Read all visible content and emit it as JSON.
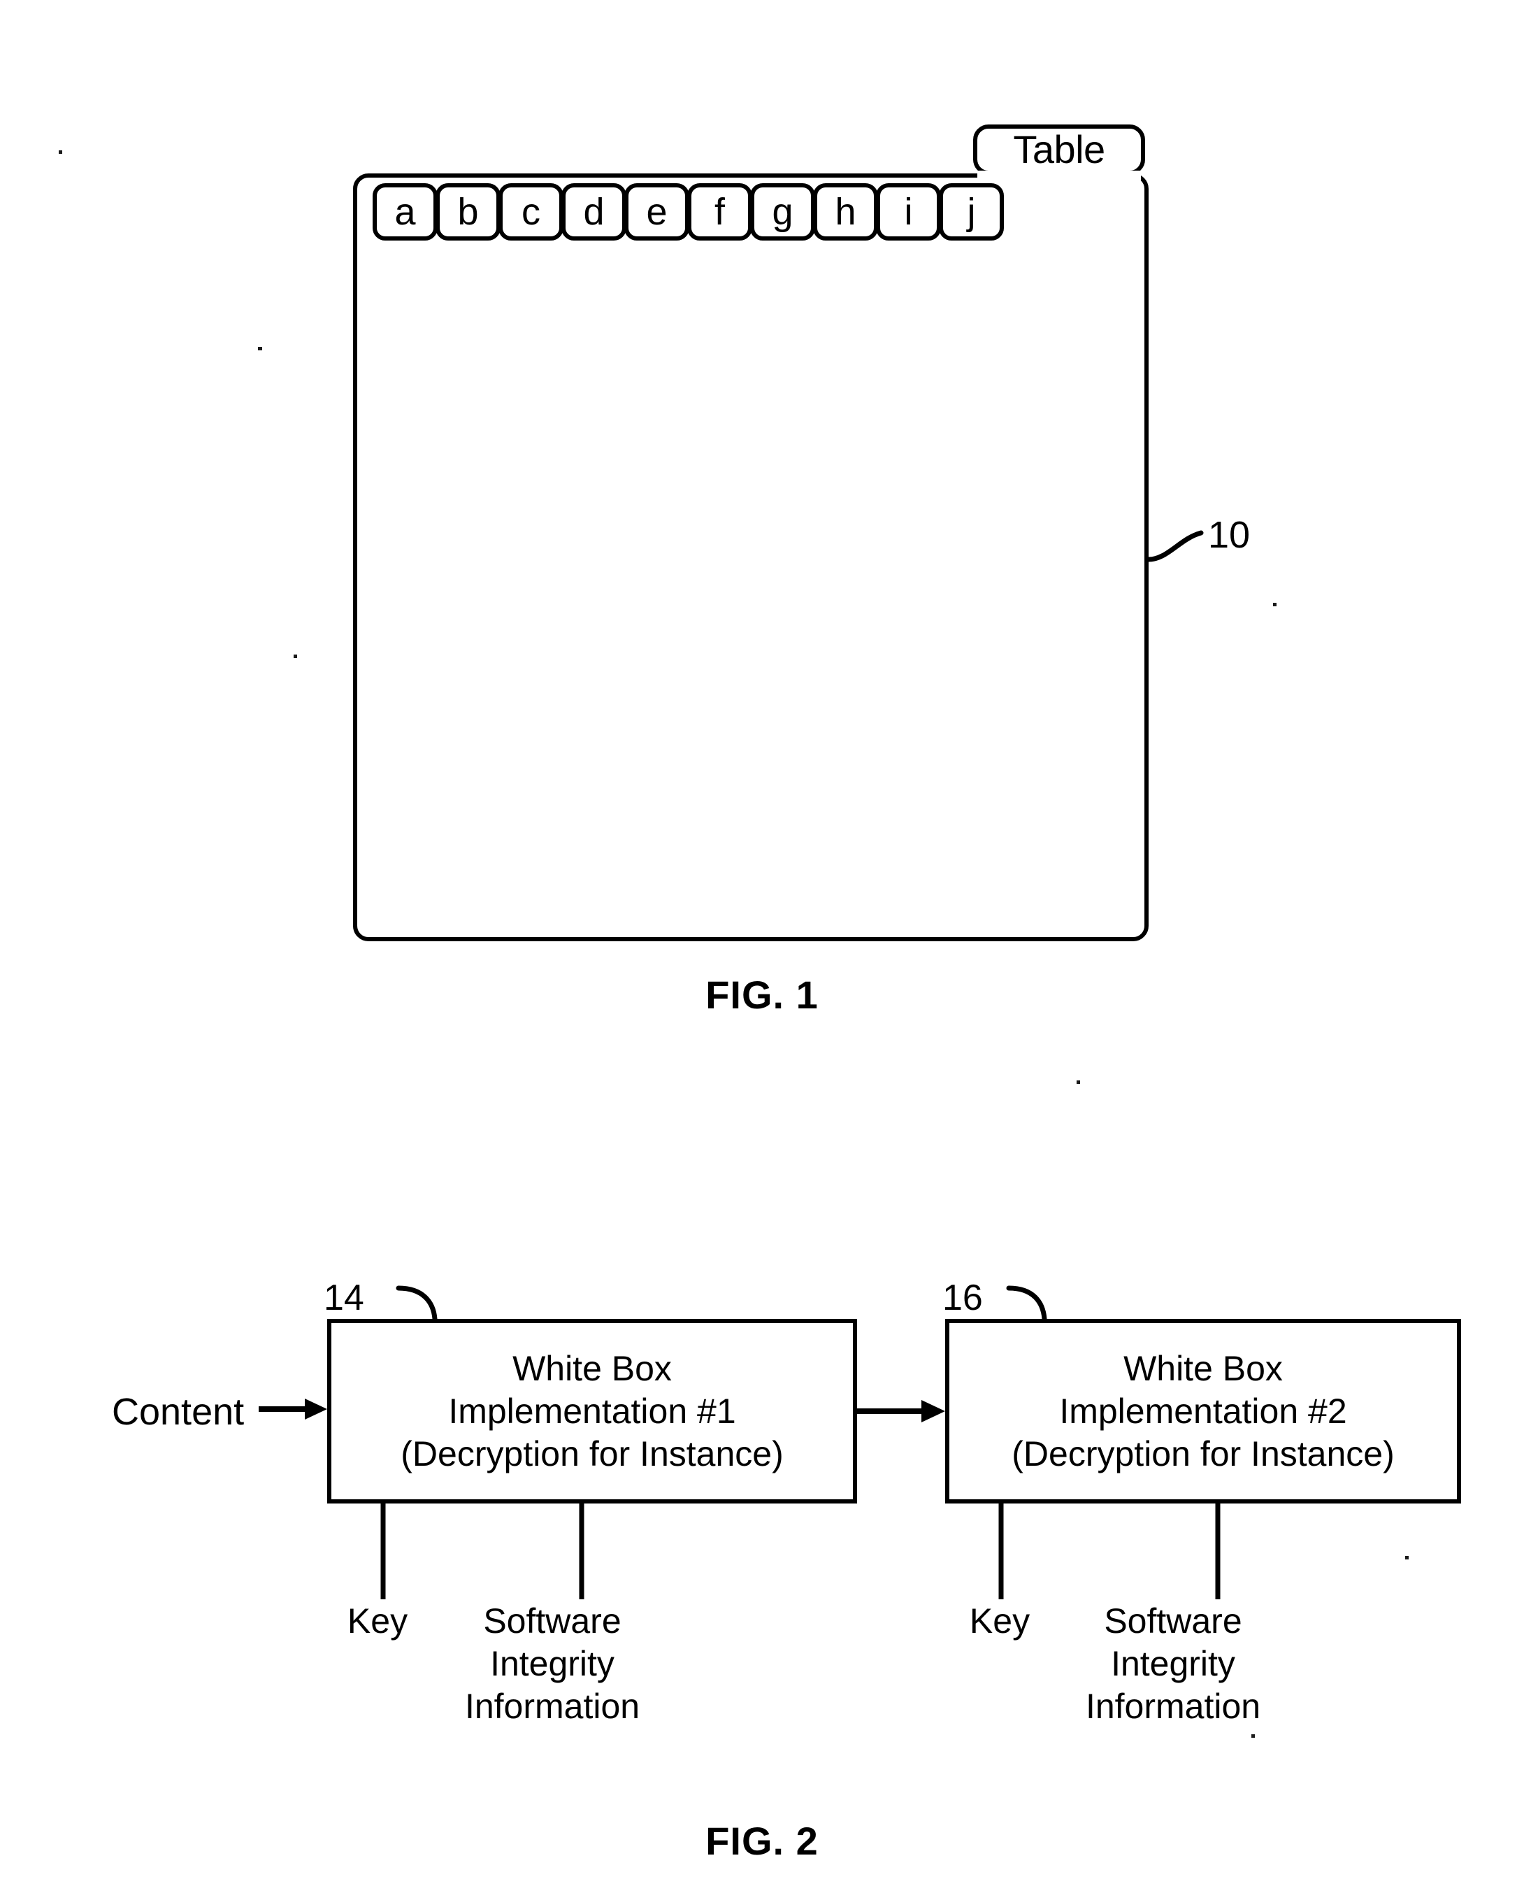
{
  "page": {
    "background_color": "#ffffff",
    "ink_color": "#000000",
    "document_type": "patent-drawing-sheet"
  },
  "fig1": {
    "caption": "FIG. 1",
    "tab_label": "Table",
    "reference_numeral": "10",
    "table_cells": [
      {
        "label": "a"
      },
      {
        "label": "b"
      },
      {
        "label": "c"
      },
      {
        "label": "d"
      },
      {
        "label": "e"
      },
      {
        "label": "f"
      },
      {
        "label": "g"
      },
      {
        "label": "h"
      },
      {
        "label": "i"
      },
      {
        "label": "j"
      }
    ]
  },
  "fig2": {
    "caption": "FIG. 2",
    "input_label": "Content",
    "blocks": [
      {
        "reference_numeral": "14",
        "line1": "White Box",
        "line2": "Implementation #1",
        "line3": "(Decryption for Instance)",
        "inputs": [
          {
            "label": "Key"
          },
          {
            "label_line1": "Software",
            "label_line2": "Integrity",
            "label_line3": "Information"
          }
        ]
      },
      {
        "reference_numeral": "16",
        "line1": "White Box",
        "line2": "Implementation #2",
        "line3": "(Decryption for Instance)",
        "inputs": [
          {
            "label": "Key"
          },
          {
            "label_line1": "Software",
            "label_line2": "Integrity",
            "label_line3": "Information"
          }
        ]
      }
    ]
  }
}
